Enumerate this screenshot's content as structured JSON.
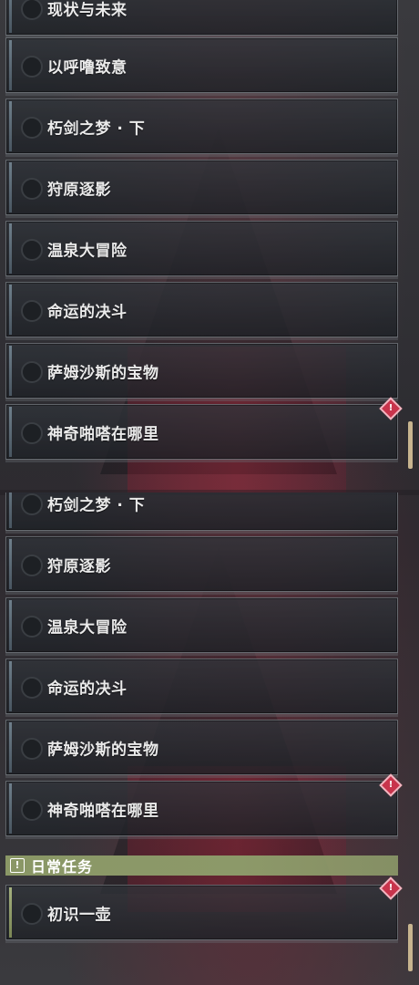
{
  "top_panel": {
    "quests": [
      {
        "label": "现状与未来",
        "alert": false
      },
      {
        "label": "以呼噜致意",
        "alert": false
      },
      {
        "label": "朽剑之梦 · 下",
        "alert": false
      },
      {
        "label": "狩原逐影",
        "alert": false
      },
      {
        "label": "温泉大冒险",
        "alert": false
      },
      {
        "label": "命运的决斗",
        "alert": false
      },
      {
        "label": "萨姆沙斯的宝物",
        "alert": false
      },
      {
        "label": "神奇啪嗒在哪里",
        "alert": true
      }
    ]
  },
  "bottom_panel": {
    "quests": [
      {
        "label": "朽剑之梦 · 下",
        "alert": false
      },
      {
        "label": "狩原逐影",
        "alert": false
      },
      {
        "label": "温泉大冒险",
        "alert": false
      },
      {
        "label": "命运的决斗",
        "alert": false
      },
      {
        "label": "萨姆沙斯的宝物",
        "alert": false
      },
      {
        "label": "神奇啪嗒在哪里",
        "alert": true
      }
    ],
    "daily_section": {
      "icon": "exclamation-icon",
      "glyph": "!",
      "title": "日常任务",
      "quests": [
        {
          "label": "初识一壶",
          "alert": true
        }
      ]
    }
  },
  "alert_glyph": "!",
  "colors": {
    "alert": "#c8344c",
    "daily_header": "#8a9766",
    "scroll_thumb": "#c7b48f",
    "label_text": "#eaeaea"
  }
}
